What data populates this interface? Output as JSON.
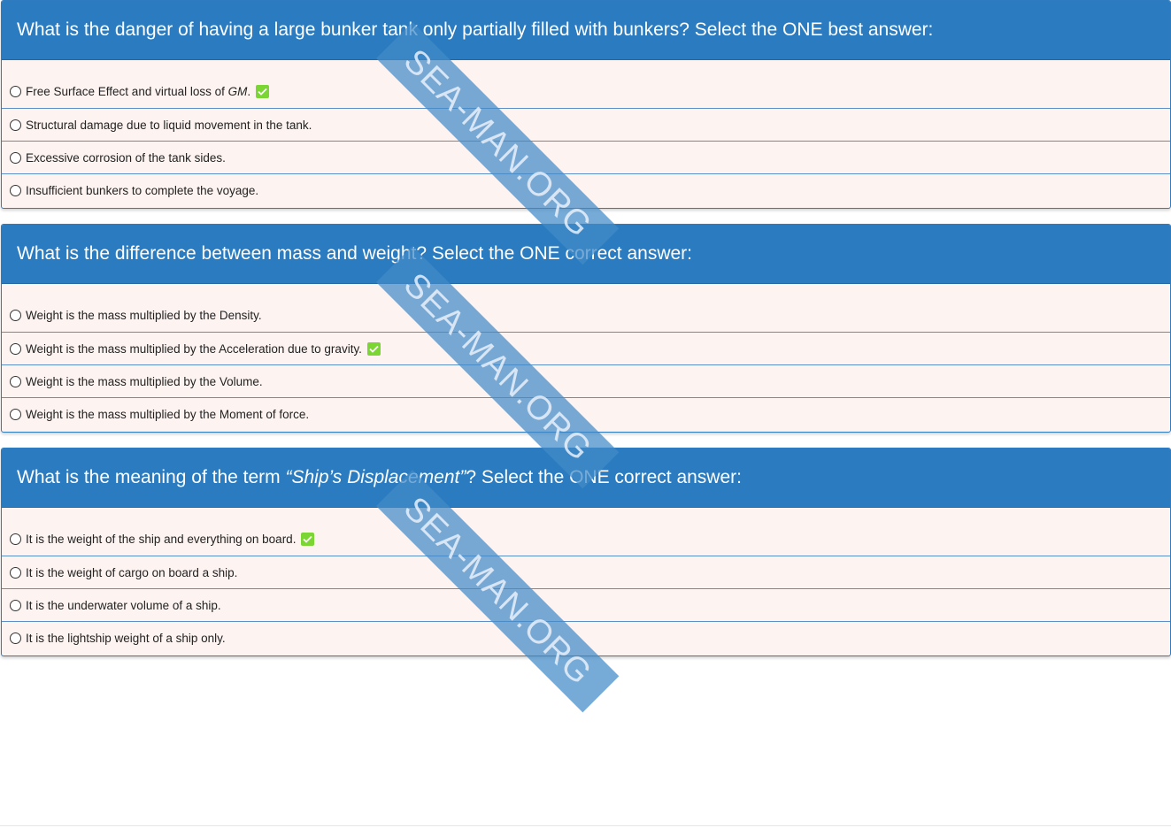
{
  "questions": [
    {
      "prompt": "What is the danger of having a large bunker tank only partially filled with bunkers? Select the ONE best answer:",
      "answers": [
        {
          "pre": "Free Surface Effect and virtual loss of ",
          "em": "GM",
          "post": ".",
          "correct": true
        },
        {
          "pre": "Structural damage due to liquid movement in the tank.",
          "em": "",
          "post": "",
          "correct": false
        },
        {
          "pre": "Excessive corrosion of the tank sides.",
          "em": "",
          "post": "",
          "correct": false
        },
        {
          "pre": "Insufficient bunkers to complete the voyage.",
          "em": "",
          "post": "",
          "correct": false
        }
      ]
    },
    {
      "prompt": "What is the difference between mass and weight? Select the ONE correct answer:",
      "answers": [
        {
          "pre": "Weight is the mass multiplied by the Density.",
          "em": "",
          "post": "",
          "correct": false
        },
        {
          "pre": "Weight is the mass multiplied by the Acceleration due to gravity.",
          "em": "",
          "post": "",
          "correct": true
        },
        {
          "pre": "Weight is the mass multiplied by the Volume.",
          "em": "",
          "post": "",
          "correct": false
        },
        {
          "pre": "Weight is the mass multiplied by the Moment of force.",
          "em": "",
          "post": "",
          "correct": false
        }
      ]
    },
    {
      "prompt_pre": "What is the meaning of the term ",
      "prompt_em": "“Ship’s Displacement”",
      "prompt_post": "? Select the ONE correct answer:",
      "answers": [
        {
          "pre": "It is the weight of the ship and everything on board.",
          "em": "",
          "post": "",
          "correct": true
        },
        {
          "pre": "It is the weight of cargo on board a ship.",
          "em": "",
          "post": "",
          "correct": false
        },
        {
          "pre": "It is the underwater volume of a ship.",
          "em": "",
          "post": "",
          "correct": false
        },
        {
          "pre": "It is the lightship weight of a ship only.",
          "em": "",
          "post": "",
          "correct": false
        }
      ]
    }
  ],
  "watermark": "SEA-MAN.ORG",
  "colors": {
    "header_bg": "#2a7bbf",
    "answer_bg": "#fdf4f1",
    "correct_check": "#7bd633",
    "watermark_band": "#428ac8"
  },
  "icons": {
    "radio": "radio-button-icon",
    "check": "checkmark-icon"
  }
}
